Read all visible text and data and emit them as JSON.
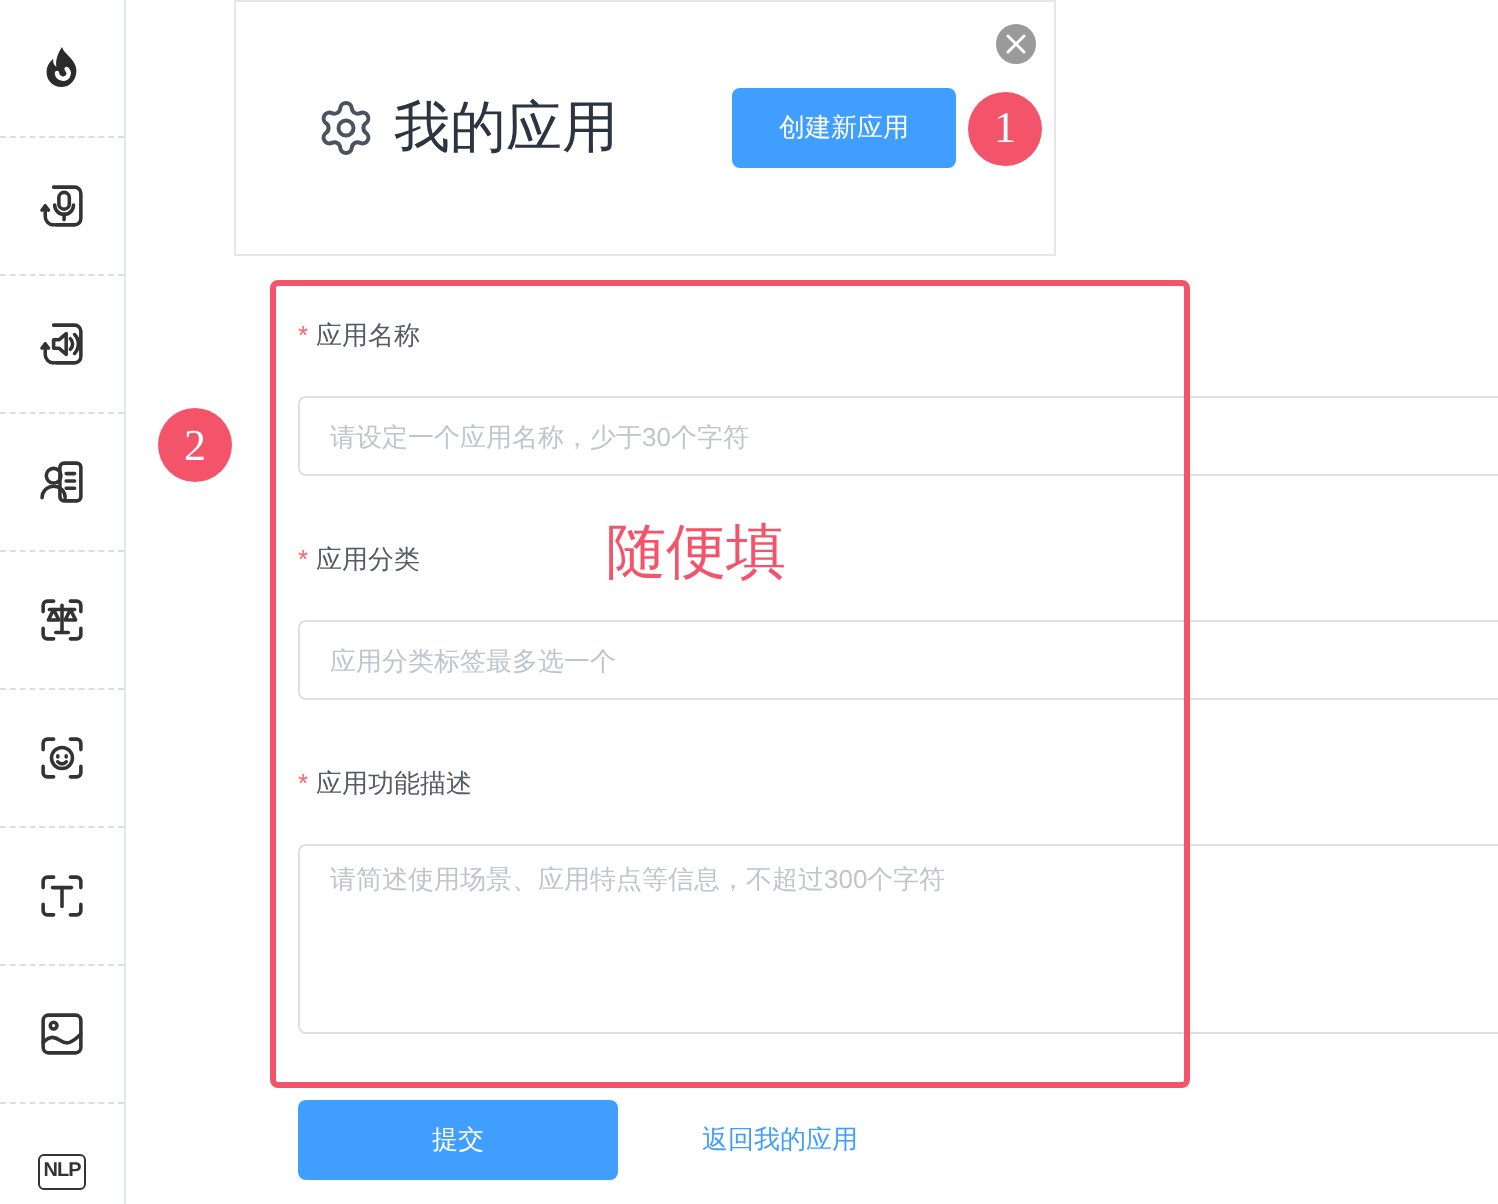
{
  "sidebar": {
    "items": [
      {
        "kind": "logo"
      },
      {
        "kind": "icon"
      },
      {
        "kind": "icon"
      },
      {
        "kind": "icon"
      },
      {
        "kind": "icon"
      },
      {
        "kind": "icon"
      },
      {
        "kind": "icon"
      },
      {
        "kind": "icon"
      },
      {
        "kind": "label",
        "label": "NLP"
      }
    ]
  },
  "header_card": {
    "title": "我的应用",
    "create_button": "创建新应用",
    "closable": true,
    "step_badge": "1"
  },
  "form": {
    "highlighted": true,
    "step_badge": "2",
    "note": "随便填",
    "fields": [
      {
        "kind": "input",
        "required_mark": "*",
        "label": "应用名称",
        "placeholder": "请设定一个应用名称，少于30个字符"
      },
      {
        "kind": "input",
        "required_mark": "*",
        "label": "应用分类",
        "placeholder": "应用分类标签最多选一个"
      },
      {
        "kind": "textarea",
        "required_mark": "*",
        "label": "应用功能描述",
        "placeholder": "请简述使用场景、应用特点等信息，不超过300个字符"
      }
    ],
    "submit_button": "提交",
    "back_link": "返回我的应用"
  }
}
